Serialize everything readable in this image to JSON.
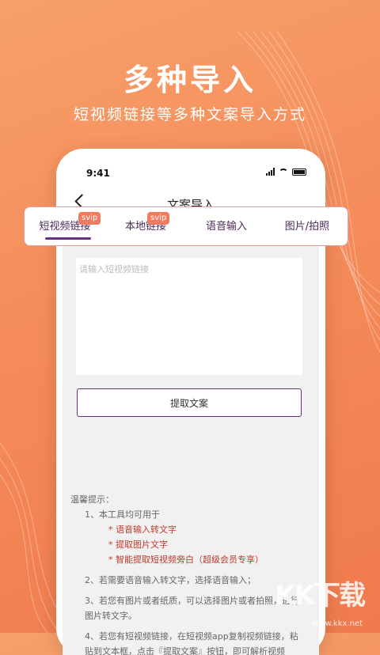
{
  "hero": {
    "title": "多种导入",
    "subtitle": "短视频链接等多种文案导入方式"
  },
  "status": {
    "time": "9:41"
  },
  "navbar": {
    "title": "文案导入"
  },
  "tabs": [
    {
      "label": "短视频链接",
      "badge": "svip",
      "active": true
    },
    {
      "label": "本地链接",
      "badge": "svip",
      "active": false
    },
    {
      "label": "语音输入",
      "badge": "",
      "active": false
    },
    {
      "label": "图片/拍照",
      "badge": "",
      "active": false
    }
  ],
  "input": {
    "placeholder": "请输入短视频链接"
  },
  "extract_button": "提取文案",
  "tips": {
    "heading": "温馨提示：",
    "item1": "1、本工具均可用于",
    "bullets": [
      "* 语音输入转文字",
      "* 提取图片文字",
      "* 智能提取短视频旁白（超级会员专享）"
    ],
    "item2": "2、若需要语音输入转文字，选择语音输入；",
    "item3a": "3、若您有图片或者纸质，可以选择图片或者拍照，进行",
    "item3b": "图片转文字。",
    "item4a": "4、若您有短视频链接，在短视频app复制视频链接，粘",
    "item4b": "贴到文本框，点击『提取文案』按钮，即可解析视频"
  },
  "watermark": {
    "logo": "KK下载",
    "url": "www.kkx.net"
  },
  "colors": {
    "accent": "#6b2f80",
    "badge": "#f07b5e",
    "background": "#f58c5a"
  }
}
